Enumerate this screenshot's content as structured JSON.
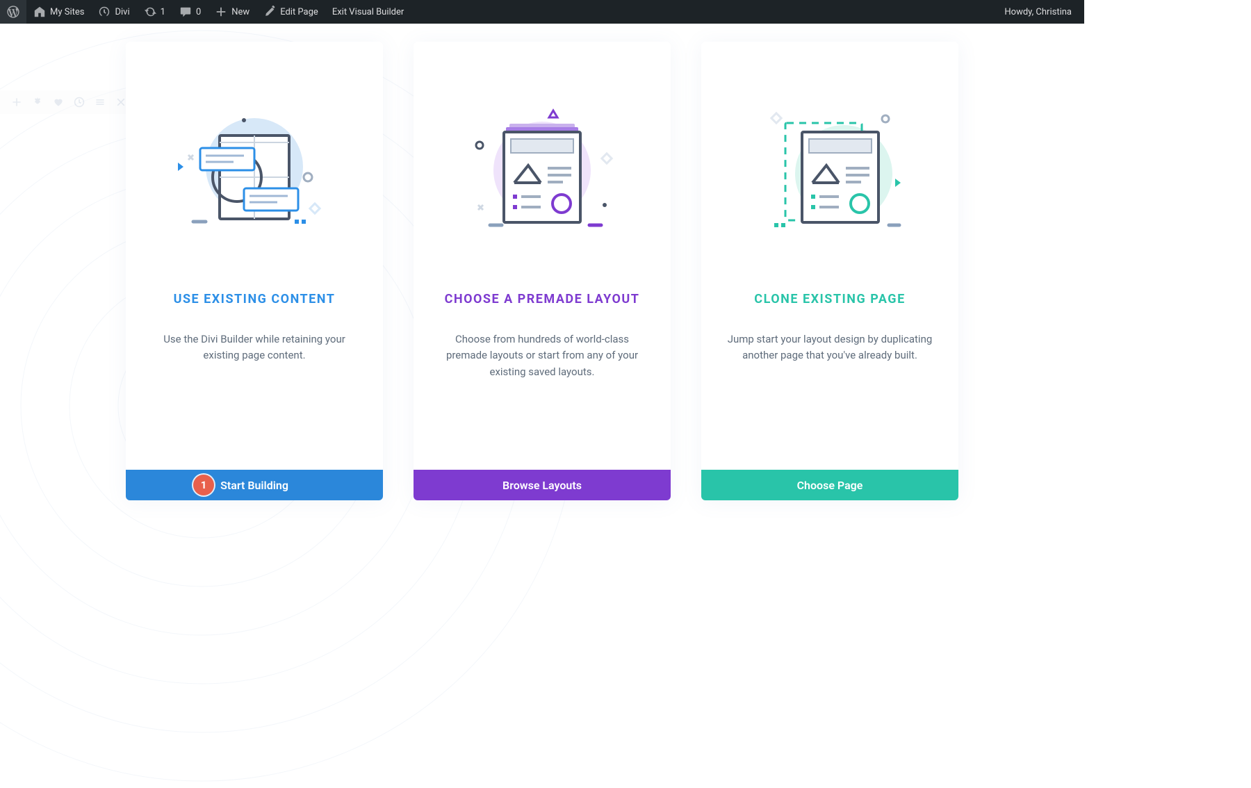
{
  "adminbar": {
    "my_sites": "My Sites",
    "site_name": "Divi",
    "updates_count": "1",
    "comments_count": "0",
    "new_label": "New",
    "edit_page": "Edit Page",
    "exit_vb": "Exit Visual Builder",
    "howdy": "Howdy, Christina"
  },
  "cards": [
    {
      "title": "USE EXISTING CONTENT",
      "desc": "Use the Divi Builder while retaining your existing page content.",
      "button": "Start Building",
      "badge": "1"
    },
    {
      "title": "CHOOSE A PREMADE LAYOUT",
      "desc": "Choose from hundreds of world-class premade layouts or start from any of your existing saved layouts.",
      "button": "Browse Layouts"
    },
    {
      "title": "CLONE EXISTING PAGE",
      "desc": "Jump start your layout design by duplicating another page that you've already built.",
      "button": "Choose Page"
    }
  ],
  "colors": {
    "blue": "#2b87da",
    "purple": "#7e3bd0",
    "teal": "#29c4a9",
    "badge": "#e8604c"
  }
}
